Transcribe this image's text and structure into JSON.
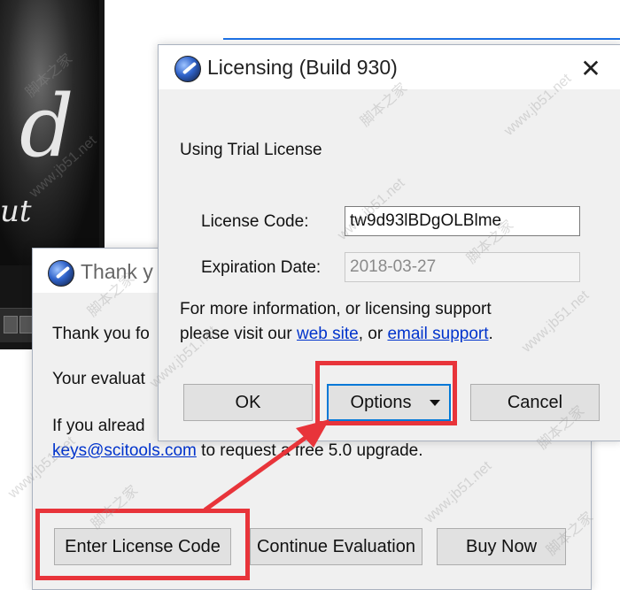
{
  "background": {
    "art_glyph": "d",
    "art_glyph_small": "ut"
  },
  "back_dialog": {
    "title": "Thank y",
    "line1": "Thank you fo",
    "line2": "Your evaluat",
    "line3": "If you alread",
    "line4_link": "keys@scitools.com",
    "line4_rest": " to request a free 5.0 upgrade.",
    "buttons": {
      "enter_license": "Enter License Code",
      "continue_eval": "Continue Evaluation",
      "buy_now": "Buy Now"
    }
  },
  "licensing_dialog": {
    "title": "Licensing (Build 930)",
    "close": "✕",
    "status": "Using Trial License",
    "license_code_label": "License Code:",
    "license_code_value": "tw9d93lBDgOLBlme",
    "expiration_label": "Expiration Date:",
    "expiration_value": "2018-03-27",
    "info_line1": "For more information, or licensing support",
    "info_line2_prefix": "please visit our ",
    "info_link_web": "web site",
    "info_mid": ", or ",
    "info_link_email": "email support",
    "info_end": ".",
    "buttons": {
      "ok": "OK",
      "options": "Options",
      "cancel": "Cancel"
    }
  },
  "annotation": {
    "highlight_color": "#e8343a",
    "watermark_cn": "脚本之家",
    "watermark_url": "www.jb51.net"
  },
  "colors": {
    "accent": "#0078d7",
    "link": "#0033cc"
  }
}
